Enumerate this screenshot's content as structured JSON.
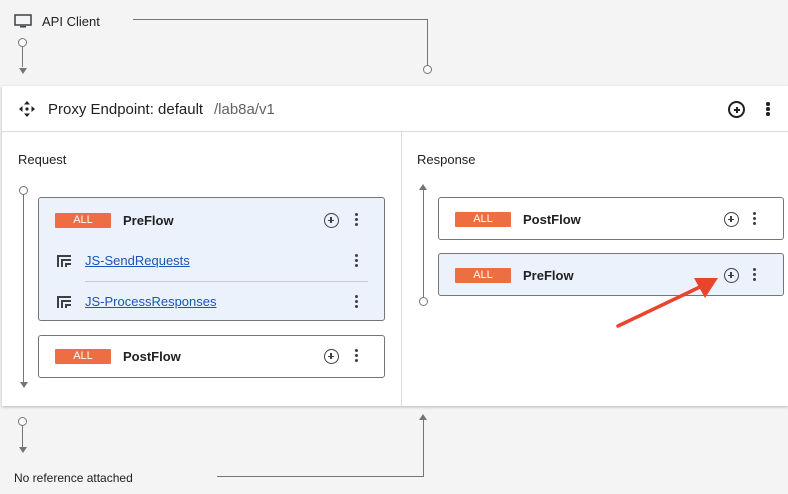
{
  "client": {
    "label": "API Client",
    "icon": "monitor-icon"
  },
  "endpoint": {
    "title": "Proxy Endpoint: default",
    "path": "/lab8a/v1",
    "icon": "move-icon"
  },
  "request": {
    "label": "Request",
    "preflow": {
      "badge": "ALL",
      "name": "PreFlow",
      "policies": [
        {
          "name": "JS-SendRequests"
        },
        {
          "name": "JS-ProcessResponses"
        }
      ]
    },
    "postflow": {
      "badge": "ALL",
      "name": "PostFlow"
    }
  },
  "response": {
    "label": "Response",
    "postflow": {
      "badge": "ALL",
      "name": "PostFlow"
    },
    "preflow": {
      "badge": "ALL",
      "name": "PreFlow"
    }
  },
  "footer": {
    "label": "No reference attached"
  },
  "colors": {
    "badge": "#ee6d43",
    "active_box": "#ecf2fb",
    "link": "#1a55b8",
    "arrow": "#e8452c"
  }
}
